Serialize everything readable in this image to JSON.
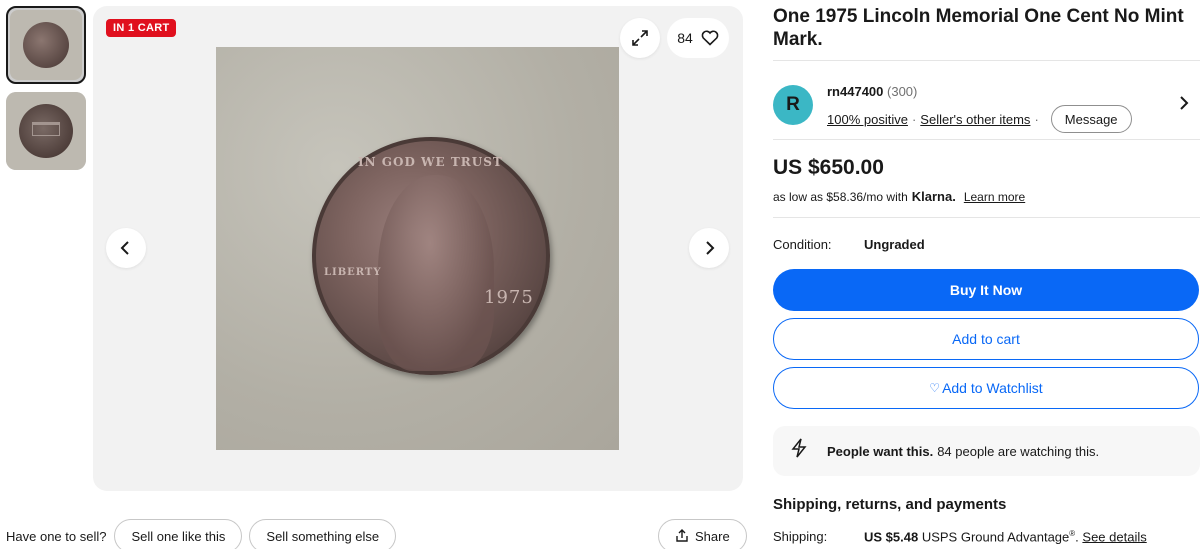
{
  "thumbnails": [
    {
      "label": "obverse"
    },
    {
      "label": "reverse"
    }
  ],
  "gallery": {
    "badge": "IN 1 CART",
    "watch_count": "84",
    "coin_motto": "IN GOD WE TRUST",
    "coin_liberty": "LIBERTY",
    "coin_year": "1975"
  },
  "bottom": {
    "have_one": "Have one to sell?",
    "sell_like": "Sell one like this",
    "sell_else": "Sell something else",
    "share": "Share"
  },
  "listing": {
    "title": "One 1975 Lincoln Memorial One Cent No Mint Mark.",
    "seller": {
      "avatar_letter": "R",
      "name": "rn447400",
      "score": "(300)",
      "positive": "100% positive",
      "other_items": "Seller's other items",
      "message": "Message"
    },
    "price": "US $650.00",
    "installments": {
      "prefix": "as low as $58.36/mo with",
      "provider": "Klarna.",
      "learn_more": "Learn more"
    },
    "condition": {
      "label": "Condition:",
      "value": "Ungraded"
    },
    "buttons": {
      "buy_now": "Buy It Now",
      "add_cart": "Add to cart",
      "watchlist": "Add to Watchlist"
    },
    "signal": {
      "bold": "People want this.",
      "text": "84 people are watching this."
    },
    "shipping": {
      "heading": "Shipping, returns, and payments",
      "label": "Shipping:",
      "price": "US $5.48",
      "service": "USPS Ground Advantage",
      "mark": "®",
      "see_details": "See details"
    }
  },
  "colors": {
    "accent": "#0968f6",
    "badge": "#e0101e",
    "avatar": "#3bb7c5"
  },
  "icons": [
    "expand-icon",
    "heart-icon",
    "chevron-left-icon",
    "chevron-right-icon",
    "share-icon",
    "bolt-icon"
  ]
}
